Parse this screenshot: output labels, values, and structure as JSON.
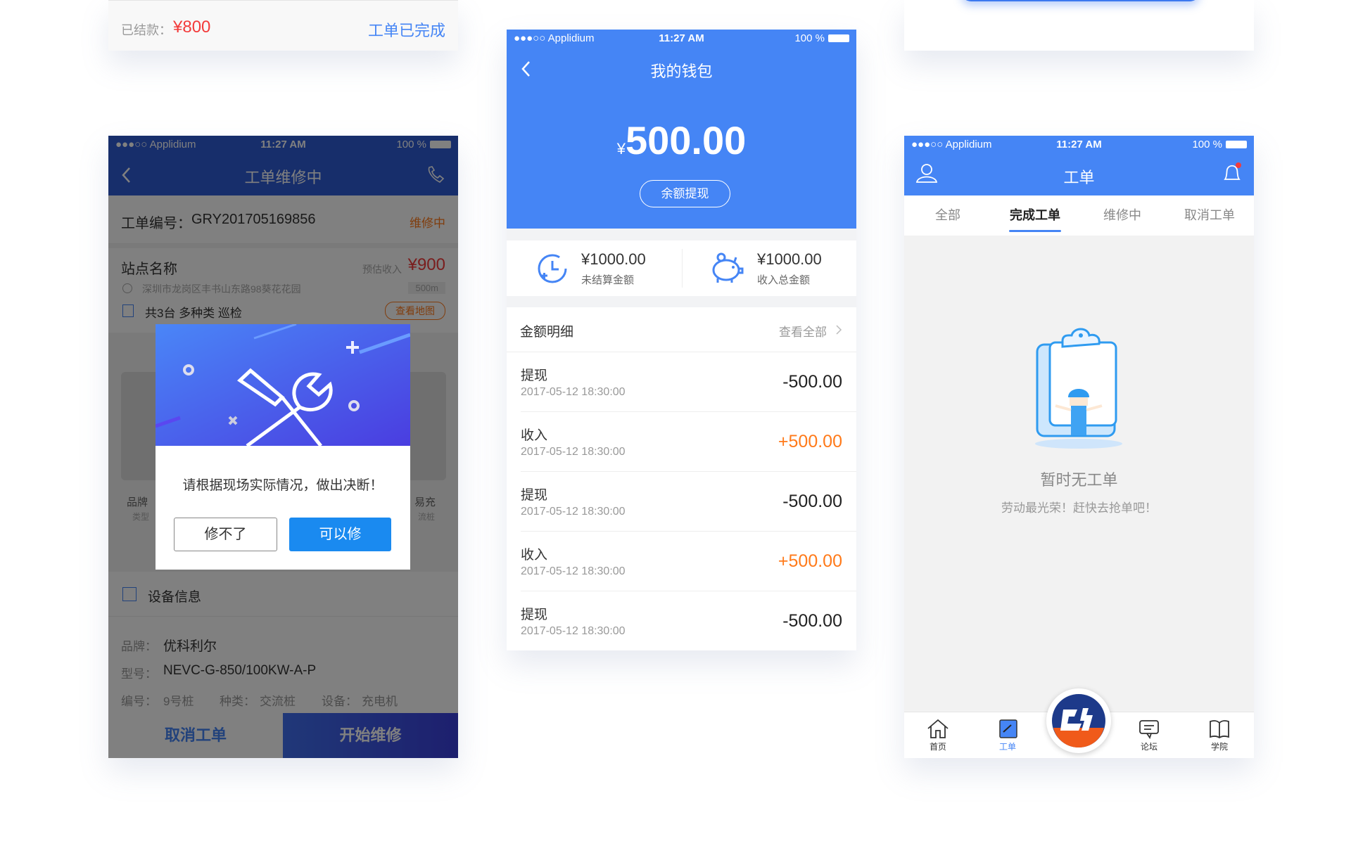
{
  "status_bar": {
    "carrier": "●●●○○ Applidium",
    "time": "11:27 AM",
    "battery": "100 %"
  },
  "top_left_card": {
    "settled_label": "已结款：",
    "settled_amount": "¥800",
    "status": "工单已完成"
  },
  "repair_screen": {
    "title": "工单维修中",
    "order_label": "工单编号：",
    "order_number": "GRY201705169856",
    "order_status": "维修中",
    "station_name": "站点名称",
    "est_income_label": "预估收入",
    "est_income": "¥900",
    "address": "深圳市龙岗区丰书山东路98葵花花园",
    "distance": "500m",
    "device_summary": "共3台 多种类 巡检",
    "map_button": "查看地图",
    "card_left": {
      "line1": "品牌",
      "line2": "类型"
    },
    "card_right": {
      "line1": "易充",
      "line2": "流桩"
    },
    "section_title": "设备信息",
    "brand_label": "品牌：",
    "brand": "优科利尔",
    "model_label": "型号：",
    "model": "NEVC-G-850/100KW-A-P",
    "num_label": "编号：",
    "num": "9号桩",
    "type_label": "种类：",
    "type": "交流桩",
    "device_label": "设备：",
    "device": "充电机",
    "cancel_button": "取消工单",
    "start_button": "开始维修",
    "modal": {
      "message": "请根据现场实际情况，做出决断！",
      "reject_button": "修不了",
      "accept_button": "可以修"
    }
  },
  "wallet_screen": {
    "title": "我的钱包",
    "currency": "¥",
    "balance": "500.00",
    "withdraw_button": "余额提现",
    "unsettled_amount": "¥1000.00",
    "unsettled_label": "未结算金额",
    "total_amount": "¥1000.00",
    "total_label": "收入总金额",
    "detail_title": "金额明细",
    "view_all": "查看全部",
    "transactions": [
      {
        "title": "提现",
        "date": "2017-05-12 18:30:00",
        "amount": "-500.00",
        "kind": "out"
      },
      {
        "title": "收入",
        "date": "2017-05-12 18:30:00",
        "amount": "+500.00",
        "kind": "in"
      },
      {
        "title": "提现",
        "date": "2017-05-12 18:30:00",
        "amount": "-500.00",
        "kind": "out"
      },
      {
        "title": "收入",
        "date": "2017-05-12 18:30:00",
        "amount": "+500.00",
        "kind": "in"
      },
      {
        "title": "提现",
        "date": "2017-05-12 18:30:00",
        "amount": "-500.00",
        "kind": "out"
      }
    ]
  },
  "orders_screen": {
    "title": "工单",
    "tabs": [
      {
        "label": "全部"
      },
      {
        "label": "完成工单",
        "active": true
      },
      {
        "label": "维修中"
      },
      {
        "label": "取消工单"
      }
    ],
    "empty_title": "暂时无工单",
    "empty_subtitle": "劳动最光荣！赶快去抢单吧！",
    "bottom_tabs": [
      {
        "label": "首页",
        "icon": "home-icon"
      },
      {
        "label": "工单",
        "icon": "work-order-icon",
        "active": true
      },
      {
        "label": "论坛",
        "icon": "forum-icon"
      },
      {
        "label": "学院",
        "icon": "book-icon"
      }
    ]
  },
  "colors": {
    "primary": "#4585f5",
    "orange": "#ff7a1a",
    "red": "#f33b3b",
    "accept": "#1a8af0",
    "income": "#ff7a1a"
  }
}
